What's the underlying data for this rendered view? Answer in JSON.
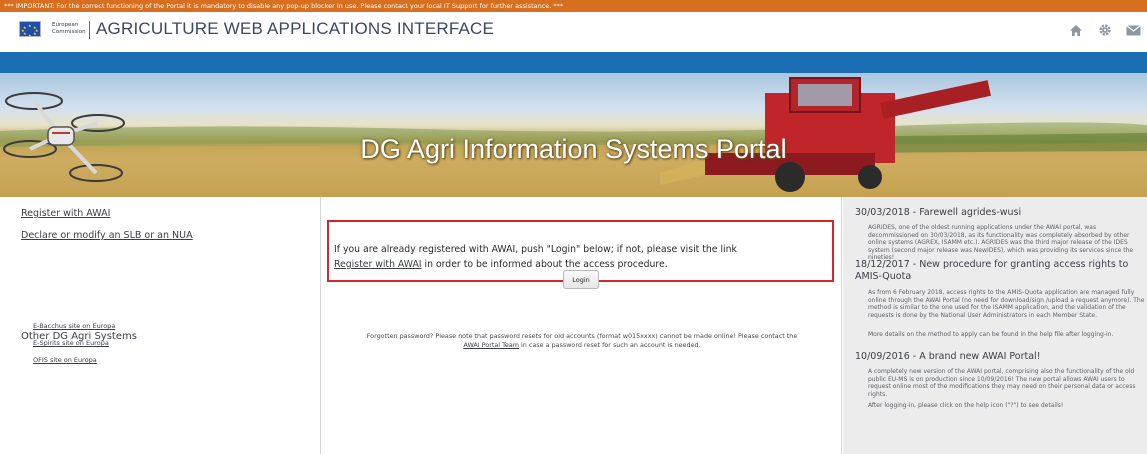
{
  "warning": "*** IMPORTANT:  For the correct functioning of the Portal it is mandatory to disable any pop-up blocker in use. Please contact your local IT Support for further assistance. ***",
  "header": {
    "ec_line1": "European",
    "ec_line2": "Commission",
    "app_title": "AGRICULTURE WEB APPLICATIONS INTERFACE",
    "icons": [
      "home-icon",
      "gear-icon",
      "envelope-icon"
    ]
  },
  "banner": {
    "title": "DG Agri Information Systems Portal"
  },
  "left": {
    "link_register": "Register with AWAI",
    "link_declare": "Declare or modify an SLB or an NUA",
    "other_title": "Other DG Agri Systems",
    "other_links": [
      "E-Bacchus site on Europa",
      "E-Spirits site on Europa",
      "OFIS site on Europa"
    ]
  },
  "main": {
    "notice_pre": "If you are already registered with AWAI, push \"Login\" below; if not, please visit the link",
    "notice_link": "Register with AWAI",
    "notice_post": " in order to be informed about the access procedure.",
    "login_label": "Login",
    "forgot_pre": "Forgotten password? Please note that password resets for old accounts (format w015xxxx) cannot be made online! Please contact the ",
    "forgot_link": "AWAI Portal Team",
    "forgot_post": " in case a password reset for such an account is needed."
  },
  "news": [
    {
      "title": "30/03/2018 - Farewell agrides-wusi",
      "body": "AGRIDES, one of the oldest running applications under the AWAI portal, was decommissioned on 30/03/2018, as its functionality was completely absorbed by other online systems (AGREX, ISAMM etc.). AGRIDES was the third major release of the IDES system (second major release was NewIDES), which was providing its services since the nineties!"
    },
    {
      "title": "18/12/2017 - New procedure for granting access rights to AMIS-Quota",
      "body": "As from 6 February 2018, access rights to the AMIS-Quota application are managed fully online through the AWAI Portal (no need for download/sign /upload a request anymore). The method is similar to the one used for the ISAMM application, and the validation of the requests is done by the National User Administrators in each Member State.",
      "body2": "More details on the method to apply can be found in the help file after logging-in."
    },
    {
      "title": "10/09/2016 - A brand new AWAI Portal!",
      "body": "A completely new version of the AWAI portal, comprising also the functionality of the old public EU-MS is on production since 10/09/2016! The new portal allows AWAI users to request online most of the modifications they may need on their personal data or access rights.",
      "body2": "After logging-in, please click on the help icon (\"?\") to see details!"
    }
  ]
}
